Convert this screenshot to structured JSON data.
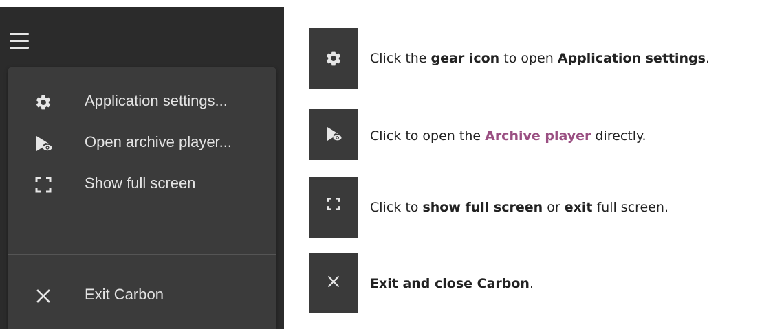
{
  "menu": {
    "items": [
      {
        "icon": "gear-icon",
        "label": "Application settings..."
      },
      {
        "icon": "archive-player-icon",
        "label": "Open archive player..."
      },
      {
        "icon": "fullscreen-icon",
        "label": "Show full screen"
      },
      {
        "icon": "close-icon",
        "label": "Exit Carbon"
      }
    ]
  },
  "legend": {
    "row1": {
      "p1": "Click the ",
      "b1": "gear icon",
      "p2": " to open ",
      "b2": "Application settings",
      "p3": "."
    },
    "row2": {
      "p1": "Click to open the ",
      "link": "Archive player",
      "p2": " directly."
    },
    "row3": {
      "p1": "Click to ",
      "b1": "show full screen",
      "p2": " or ",
      "b2": "exit",
      "p3": " full screen."
    },
    "row4": {
      "b1": "Exit and close Carbon",
      "p1": "."
    }
  },
  "colors": {
    "panel": "#2b2b2b",
    "dropdown": "#3b3b3b",
    "tile": "#3a3a3a",
    "link": "#9a4f82"
  }
}
